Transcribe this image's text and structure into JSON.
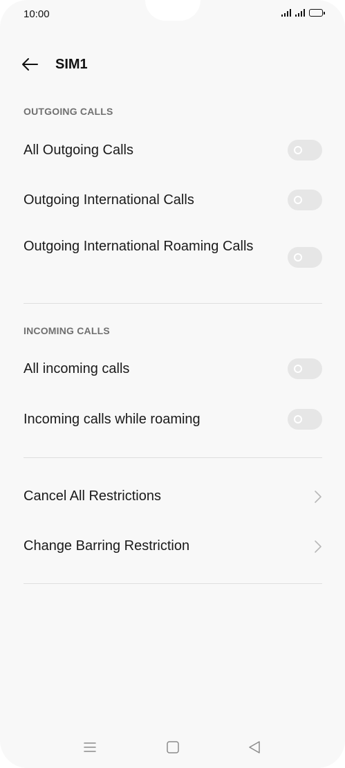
{
  "status_bar": {
    "time": "10:00"
  },
  "header": {
    "title": "SIM1",
    "back_icon": "arrow-left-icon"
  },
  "sections": {
    "outgoing": {
      "title": "OUTGOING CALLS",
      "items": [
        {
          "label": "All Outgoing Calls",
          "enabled": false
        },
        {
          "label": "Outgoing International Calls",
          "enabled": false
        },
        {
          "label": "Outgoing International Roaming Calls",
          "enabled": false
        }
      ]
    },
    "incoming": {
      "title": "INCOMING CALLS",
      "items": [
        {
          "label": "All incoming calls",
          "enabled": false
        },
        {
          "label": "Incoming calls while roaming",
          "enabled": false
        }
      ]
    },
    "actions": {
      "items": [
        {
          "label": "Cancel All Restrictions",
          "icon": "chevron-right-icon"
        },
        {
          "label": "Change Barring Restriction",
          "icon": "chevron-right-icon"
        }
      ]
    }
  },
  "nav_bar": {
    "icons": [
      "menu-icon",
      "home-icon",
      "back-triangle-icon"
    ]
  },
  "colors": {
    "background": "#f8f8f8",
    "toggle_off": "#e6e6e6",
    "section_header": "#707070",
    "divider": "#dedede",
    "text": "#1a1a1a"
  }
}
